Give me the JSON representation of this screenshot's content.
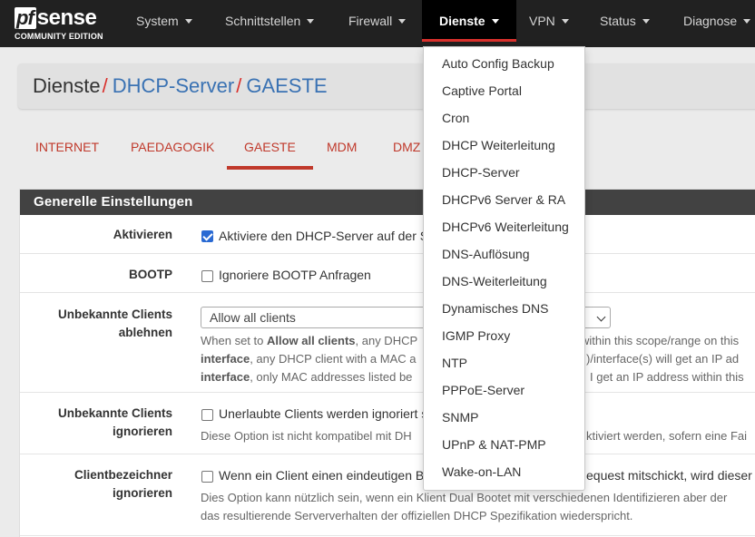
{
  "logo": {
    "mark": "pf",
    "word": "sense",
    "subtitle": "COMMUNITY EDITION"
  },
  "nav": [
    {
      "label": "System"
    },
    {
      "label": "Schnittstellen"
    },
    {
      "label": "Firewall"
    },
    {
      "label": "Dienste",
      "active": true
    },
    {
      "label": "VPN"
    },
    {
      "label": "Status"
    },
    {
      "label": "Diagnose"
    }
  ],
  "breadcrumb": {
    "first": "Dienste",
    "sep": "/",
    "second": "DHCP-Server",
    "third": "GAESTE"
  },
  "tabs": [
    "INTERNET",
    "PAEDAGOGIK",
    "GAESTE",
    "MDM",
    "DMZ"
  ],
  "active_tab": "GAESTE",
  "panel": {
    "title": "Generelle Einstellungen",
    "rows": {
      "aktivieren": {
        "label": "Aktivieren",
        "checked": true,
        "text": "Aktiviere den DHCP-Server auf der Sc"
      },
      "bootp": {
        "label": "BOOTP",
        "checked": false,
        "text": "Ignoriere BOOTP Anfragen"
      },
      "unbekannte_ablehnen": {
        "label_line1": "Unbekannte Clients",
        "label_line2": "ablehnen",
        "select_value": "Allow all clients",
        "help1_pre": "When set to ",
        "help1_bold": "Allow all clients",
        "help1_post": ", any DHCP",
        "help1_right": "within this scope/range on this",
        "help2_bold": "interface",
        "help2_post": ", any DHCP client with a MAC a",
        "help2_right": ")/interface(s) will get an IP ad",
        "help3_bold": "interface",
        "help3_post": ", only MAC addresses listed be",
        "help3_right": "I get an IP address within this"
      },
      "unbekannte_ignorieren": {
        "label_line1": "Unbekannte Clients",
        "label_line2": "ignorieren",
        "checked": false,
        "text": "Unerlaubte Clients werden ignoriert s",
        "help_left": "Diese Option ist nicht kompatibel mit DH",
        "help_right": "ktiviert werden, sofern eine Fai"
      },
      "clientbezeichner": {
        "label_line1": "Clientbezeichner",
        "label_line2": "ignorieren",
        "checked": false,
        "text": "Wenn ein Client einen eindeutigen Be",
        "text_right": "equest mitschickt, wird dieser U",
        "help1": "Dies Option kann nützlich sein, wenn ein Klient Dual Bootet mit verschiedenen Identifizieren aber der",
        "help2": "das resultierende Serververhalten der offiziellen DHCP Spezifikation wiederspricht."
      }
    }
  },
  "dropdown": [
    "Auto Config Backup",
    "Captive Portal",
    "Cron",
    "DHCP Weiterleitung",
    "DHCP-Server",
    "DHCPv6 Server & RA",
    "DHCPv6 Weiterleitung",
    "DNS-Auflösung",
    "DNS-Weiterleitung",
    "Dynamisches DNS",
    "IGMP Proxy",
    "NTP",
    "PPPoE-Server",
    "SNMP",
    "UPnP & NAT-PMP",
    "Wake-on-LAN"
  ],
  "colors": {
    "navbar": "#212121",
    "accent_red": "#d9302c",
    "link_blue": "#3a72b3",
    "tab_red": "#c0392b",
    "panel_head": "#424242",
    "checkbox_blue": "#2a6ad3"
  }
}
